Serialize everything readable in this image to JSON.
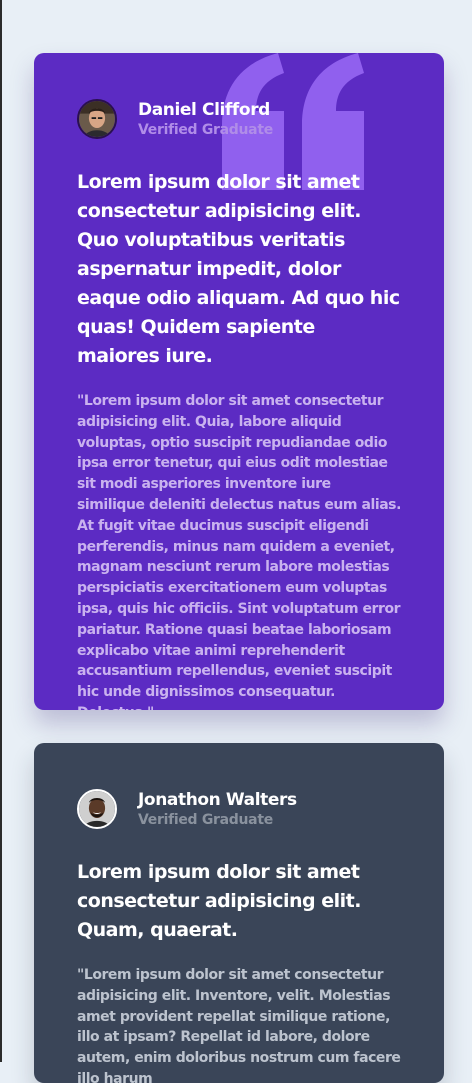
{
  "colors": {
    "background": "#e8eff6",
    "card_primary": "#5c2bc3",
    "card_secondary": "#3a4558",
    "quote_mark": "#9060ee"
  },
  "testimonials": [
    {
      "author_name": "Daniel Clifford",
      "author_role": "Verified Graduate",
      "avatar_icon": "avatar-photo-daniel",
      "headline": "Lorem ipsum dolor sit amet consectetur adipisicing elit. Quo voluptatibus veritatis aspernatur impedit, dolor eaque odio aliquam. Ad quo hic quas! Quidem sapiente maiores iure.",
      "quote": "\"Lorem ipsum dolor sit amet consectetur adipisicing elit. Quia, labore aliquid voluptas, optio suscipit repudiandae odio ipsa error tenetur, qui eius odit molestiae sit modi asperiores inventore iure similique deleniti delectus natus eum alias. At fugit vitae ducimus suscipit eligendi perferendis, minus nam quidem a eveniet, magnam nesciunt rerum labore molestias perspiciatis exercitationem eum voluptas ipsa, quis hic officiis. Sint voluptatum error pariatur. Ratione quasi beatae laboriosam explicabo vitae animi reprehenderit accusantium repellendus, eveniet suscipit hic unde dignissimos consequatur. Delectus.\""
    },
    {
      "author_name": "Jonathon Walters",
      "author_role": "Verified Graduate",
      "avatar_icon": "avatar-photo-jonathon",
      "headline": "Lorem ipsum dolor sit amet consectetur adipisicing elit. Quam, quaerat.",
      "quote": "\"Lorem ipsum dolor sit amet consectetur adipisicing elit. Inventore, velit. Molestias amet provident repellat similique ratione, illo at ipsam? Repellat id labore, dolore autem, enim doloribus nostrum cum facere illo harum"
    }
  ]
}
